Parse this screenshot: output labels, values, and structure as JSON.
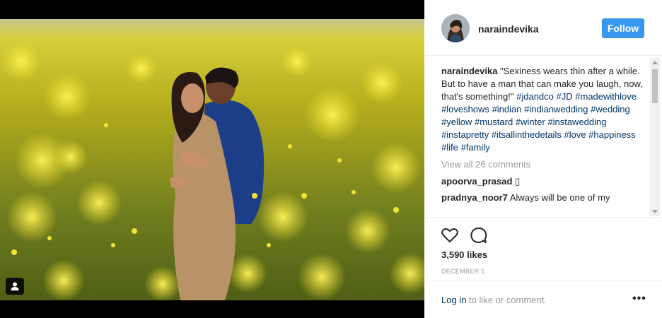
{
  "post": {
    "username": "naraindevika",
    "follow_label": "Follow",
    "caption_text": "\"Sexiness wears thin after a while. But to have a man that can make you laugh, now, that's something!\"",
    "hashtags": [
      "#jdandco",
      "#JD",
      "#madewithlove",
      "#loveshows",
      "#indian",
      "#indianwedding",
      "#wedding",
      "#yellow",
      "#mustard",
      "#winter",
      "#instawedding",
      "#instapretty",
      "#itsallinthedetails",
      "#love",
      "#happiness",
      "#life",
      "#family"
    ],
    "view_all_comments": "View all 26 comments",
    "comments": [
      {
        "user": "apoorva_prasad",
        "text": "▯"
      },
      {
        "user": "pradnya_noor7",
        "text": "Always will be one of my"
      }
    ],
    "likes": "3,590 likes",
    "date": "DECEMBER 1",
    "login_link": "Log in",
    "login_rest": " to like or comment.",
    "more_label": "•••"
  },
  "icons": {
    "like": "heart-icon",
    "comment": "comment-bubble-icon",
    "user_tag": "person-icon",
    "more": "more-options-icon"
  },
  "colors": {
    "follow_bg": "#3897f0",
    "hashtag": "#003569",
    "muted": "#999999",
    "text": "#262626"
  }
}
